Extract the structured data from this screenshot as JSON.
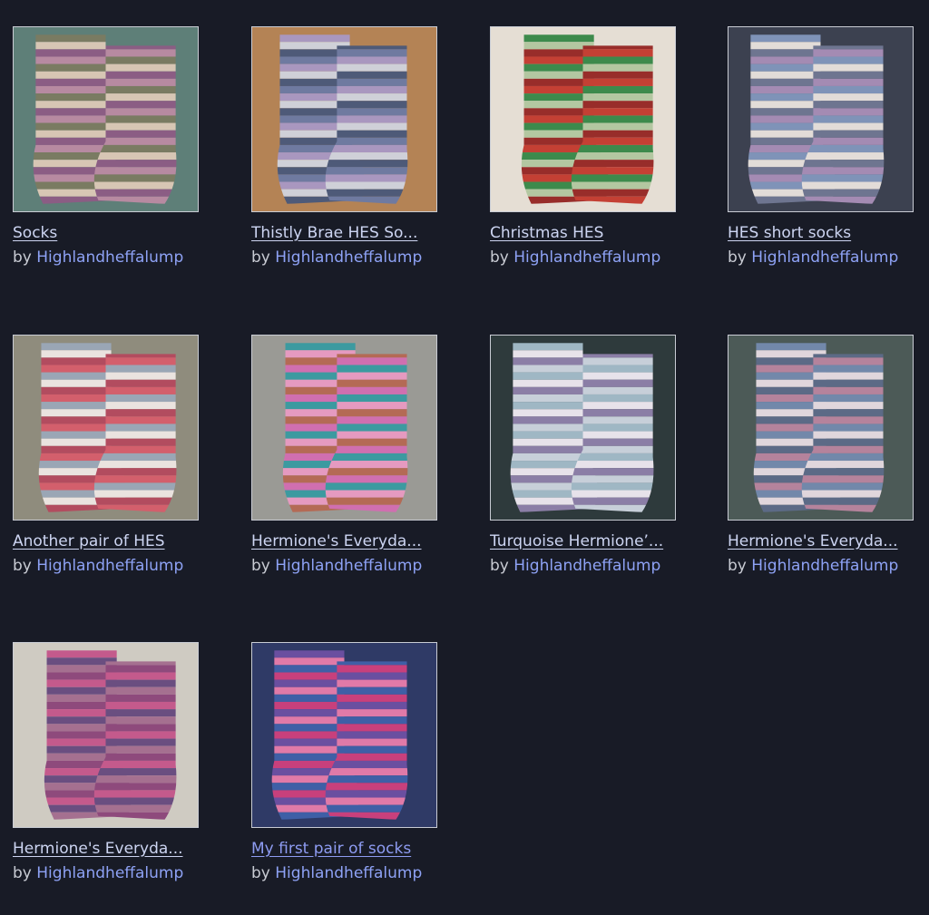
{
  "by_label": "by",
  "projects": [
    {
      "title": "Socks",
      "author": "Highlandheffalump",
      "visited": false,
      "palette": [
        "#5e7f78",
        "#b78aa1",
        "#7a7b62",
        "#d7c6b4",
        "#8b5d84"
      ]
    },
    {
      "title": "Thistly Brae HES So...",
      "author": "Highlandheffalump",
      "visited": false,
      "palette": [
        "#b48355",
        "#6f7aa0",
        "#a997bf",
        "#cfd0d8",
        "#4e5a78"
      ]
    },
    {
      "title": "Christmas HES",
      "author": "Highlandheffalump",
      "visited": false,
      "palette": [
        "#e5ded4",
        "#c44034",
        "#3d8a4c",
        "#b3c7a1",
        "#982d2a"
      ]
    },
    {
      "title": "HES short socks",
      "author": "Highlandheffalump",
      "visited": false,
      "palette": [
        "#3c4150",
        "#a48bb3",
        "#7f93b8",
        "#e2dcd8",
        "#6e7590"
      ]
    },
    {
      "title": "Another pair of HES",
      "author": "Highlandheffalump",
      "visited": false,
      "palette": [
        "#8f8c7d",
        "#d35f6c",
        "#9aa6b5",
        "#eae3df",
        "#b24c5f"
      ]
    },
    {
      "title": "Hermione's Everyda...",
      "author": "Highlandheffalump",
      "visited": false,
      "palette": [
        "#9a9a95",
        "#d06fb0",
        "#3c9aa0",
        "#e59ac0",
        "#b46a55"
      ]
    },
    {
      "title": "Turquoise Hermione’...",
      "author": "Highlandheffalump",
      "visited": false,
      "palette": [
        "#2e3a3c",
        "#c7cfd9",
        "#9fb7c4",
        "#e7e2ea",
        "#8b7ea6"
      ]
    },
    {
      "title": "Hermione's Everyda...",
      "author": "Highlandheffalump",
      "visited": false,
      "palette": [
        "#4c5a57",
        "#b5839c",
        "#7288aa",
        "#e0d6dc",
        "#5c6a86"
      ]
    },
    {
      "title": "Hermione's Everyda...",
      "author": "Highlandheffalump",
      "visited": false,
      "palette": [
        "#cfcbc2",
        "#8e4a7c",
        "#c45a8c",
        "#6a4e80",
        "#a57090"
      ]
    },
    {
      "title": "My first pair of socks",
      "author": "Highlandheffalump",
      "visited": true,
      "palette": [
        "#2f3a66",
        "#c8407c",
        "#6a4fa0",
        "#e07aa8",
        "#3f5fa6"
      ]
    }
  ]
}
